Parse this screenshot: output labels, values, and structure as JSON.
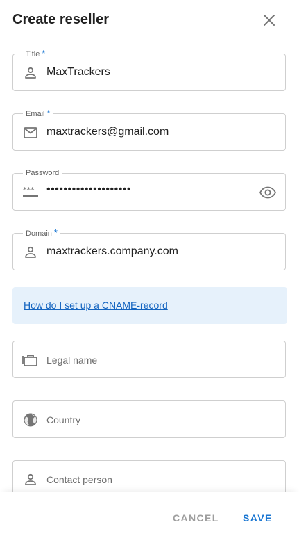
{
  "dialog": {
    "title": "Create reseller",
    "close_icon": "close-icon"
  },
  "fields": {
    "title": {
      "label": "Title",
      "required_mark": "*",
      "value": "MaxTrackers",
      "icon": "person-icon"
    },
    "email": {
      "label": "Email",
      "required_mark": "*",
      "value": "maxtrackers@gmail.com",
      "icon": "mail-icon"
    },
    "password": {
      "label": "Password",
      "value": "••••••••••••••••••••",
      "icon": "password-icon",
      "toggle_icon": "eye-icon"
    },
    "domain": {
      "label": "Domain",
      "required_mark": "*",
      "value": "maxtrackers.company.com",
      "icon": "person-icon"
    },
    "legal_name": {
      "placeholder": "Legal name",
      "icon": "briefcase-icon"
    },
    "country": {
      "placeholder": "Country",
      "icon": "globe-icon"
    },
    "contact_person": {
      "placeholder": "Contact person",
      "icon": "person-icon"
    }
  },
  "info": {
    "link_text": "How do I set up a CNAME-record"
  },
  "footer": {
    "cancel_label": "CANCEL",
    "save_label": "SAVE"
  },
  "colors": {
    "accent": "#1976d2",
    "info_bg": "#e6f1fb",
    "border": "#cfcfcf"
  }
}
